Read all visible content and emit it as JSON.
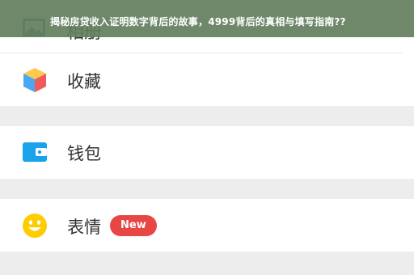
{
  "banner": {
    "text": "揭秘房贷收入证明数字背后的故事，4999背后的真相与填写指南??"
  },
  "menu": {
    "top_item": {
      "label": "相册",
      "icon": "photo-icon"
    },
    "favorites": {
      "label": "收藏",
      "icon": "cube-icon"
    },
    "wallet": {
      "label": "钱包",
      "icon": "wallet-icon"
    },
    "emoji": {
      "label": "表情",
      "icon": "smiley-icon",
      "badge": "New"
    }
  },
  "colors": {
    "banner_bg": "#627e5c",
    "badge_bg": "#e84545",
    "wallet_icon": "#1aa3ea",
    "smiley_icon": "#ffcc00",
    "separator_bg": "#ededed"
  }
}
